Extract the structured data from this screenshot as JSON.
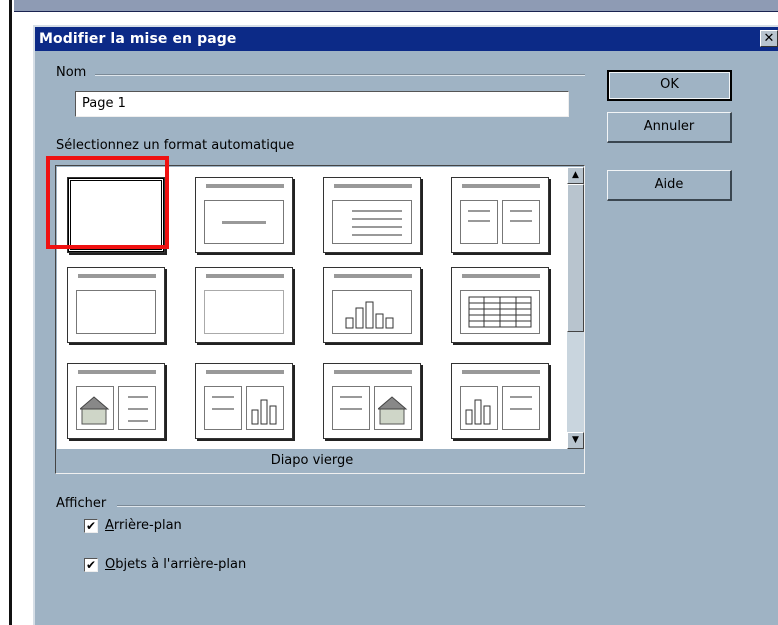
{
  "window": {
    "title": "Modifier la mise en page",
    "close_glyph": "✕"
  },
  "name_group": {
    "label": "Nom",
    "value": "Page 1"
  },
  "buttons": {
    "ok": "OK",
    "cancel": "Annuler",
    "help": "Aide"
  },
  "autolayout": {
    "label": "Sélectionnez un format automatique",
    "selected_caption": "Diapo vierge",
    "layouts": [
      {
        "icon": "blank-layout-icon"
      },
      {
        "icon": "title-slide-layout-icon"
      },
      {
        "icon": "title-text-layout-icon"
      },
      {
        "icon": "title-two-text-layout-icon"
      },
      {
        "icon": "title-only-layout-icon"
      },
      {
        "icon": "title-object-layout-icon"
      },
      {
        "icon": "title-chart-layout-icon"
      },
      {
        "icon": "title-table-layout-icon"
      },
      {
        "icon": "image-text-layout-icon"
      },
      {
        "icon": "text-chart-layout-icon"
      },
      {
        "icon": "text-image-layout-icon"
      },
      {
        "icon": "chart-text-layout-icon"
      }
    ]
  },
  "display_group": {
    "label": "Afficher",
    "options": [
      {
        "mnemonic": "A",
        "rest": "rrière-plan",
        "checked": true
      },
      {
        "mnemonic": "O",
        "rest": "bjets à l'arrière-plan",
        "checked": true
      }
    ]
  },
  "colors": {
    "title_bar": "#0c2a87",
    "dialog_bg": "#9fb3c4",
    "highlight": "#ef1111"
  }
}
